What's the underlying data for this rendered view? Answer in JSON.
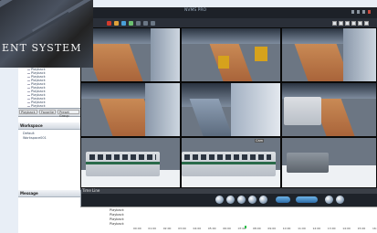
{
  "window": {
    "title": "NVMS PRO",
    "titlebar_buttons": [
      "#d33a2c",
      "#e0a23a",
      "#4aa0d8",
      "#6cc070"
    ]
  },
  "logo": {
    "text": "ENT SYSTEM"
  },
  "left_panel": {
    "tree_items": [
      "Playback",
      "Playback",
      "Playback",
      "Playback",
      "Playback",
      "Playback",
      "Playback",
      "Playback",
      "Playback",
      "Playback",
      "Playback",
      "Playback",
      "Playback",
      "Playback",
      "Playback",
      "Playback"
    ],
    "tabs": [
      "Playback",
      "Favorite",
      "Preset Group"
    ],
    "workspace_header": "Workspace",
    "workspace_items": [
      "Default",
      "Workspace001"
    ],
    "message_header": "Message"
  },
  "cameras": [
    {
      "title": "",
      "stamp": ""
    },
    {
      "title": "",
      "stamp": ""
    },
    {
      "title": "",
      "stamp": ""
    },
    {
      "title": "",
      "stamp": ""
    },
    {
      "title": "",
      "stamp": ""
    },
    {
      "title": "",
      "stamp": ""
    },
    {
      "title": "",
      "stamp": ""
    },
    {
      "title": "Cam",
      "stamp": ""
    },
    {
      "title": "",
      "stamp": ""
    }
  ],
  "playback": {
    "section_label": "Time Line",
    "timeline_rows": [
      "Playback",
      "Playback",
      "Playback",
      "Playback"
    ],
    "time_ticks": [
      "00:00",
      "01:00",
      "02:00",
      "03:00",
      "04:00",
      "05:00",
      "06:00",
      "07:00",
      "08:00",
      "09:00",
      "10:00",
      "11:00",
      "12:00",
      "13:00",
      "14:00",
      "15:00",
      "16:00"
    ],
    "speed_label": "1X"
  },
  "colors": {
    "accent": "#2b6aa6",
    "titlebar": "#1d2128",
    "timeline_marker": "#2cbf4a"
  }
}
